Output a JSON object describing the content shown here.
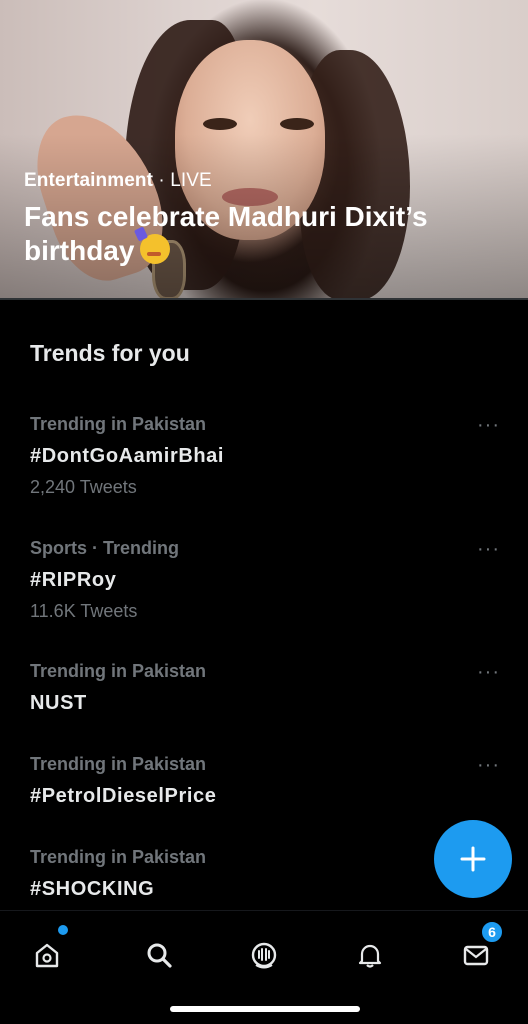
{
  "hero": {
    "category": "Entertainment",
    "separator": " · ",
    "status": "LIVE",
    "title": "Fans celebrate Madhuri Dixit’s birthday"
  },
  "trends": {
    "title": "Trends for you",
    "items": [
      {
        "meta": "Trending in Pakistan",
        "tag": "#DontGoAamirBhai",
        "count": "2,240 Tweets"
      },
      {
        "meta": "Sports · Trending",
        "tag": "#RIPRoy",
        "count": "11.6K Tweets"
      },
      {
        "meta": "Trending in Pakistan",
        "tag": "NUST",
        "count": ""
      },
      {
        "meta": "Trending in Pakistan",
        "tag": "#PetrolDieselPrice",
        "count": ""
      },
      {
        "meta": "Trending in Pakistan",
        "tag": "#SHOCKING",
        "count": ""
      }
    ],
    "more_label": "···"
  },
  "tabbar": {
    "icons": [
      "home-icon",
      "search-icon",
      "spaces-icon",
      "notifications-icon",
      "messages-icon"
    ],
    "messages_badge": "6"
  },
  "colors": {
    "accent": "#1d9bf0",
    "background": "#000000",
    "secondary_text": "#71767b",
    "primary_text": "#e7e9ea"
  }
}
